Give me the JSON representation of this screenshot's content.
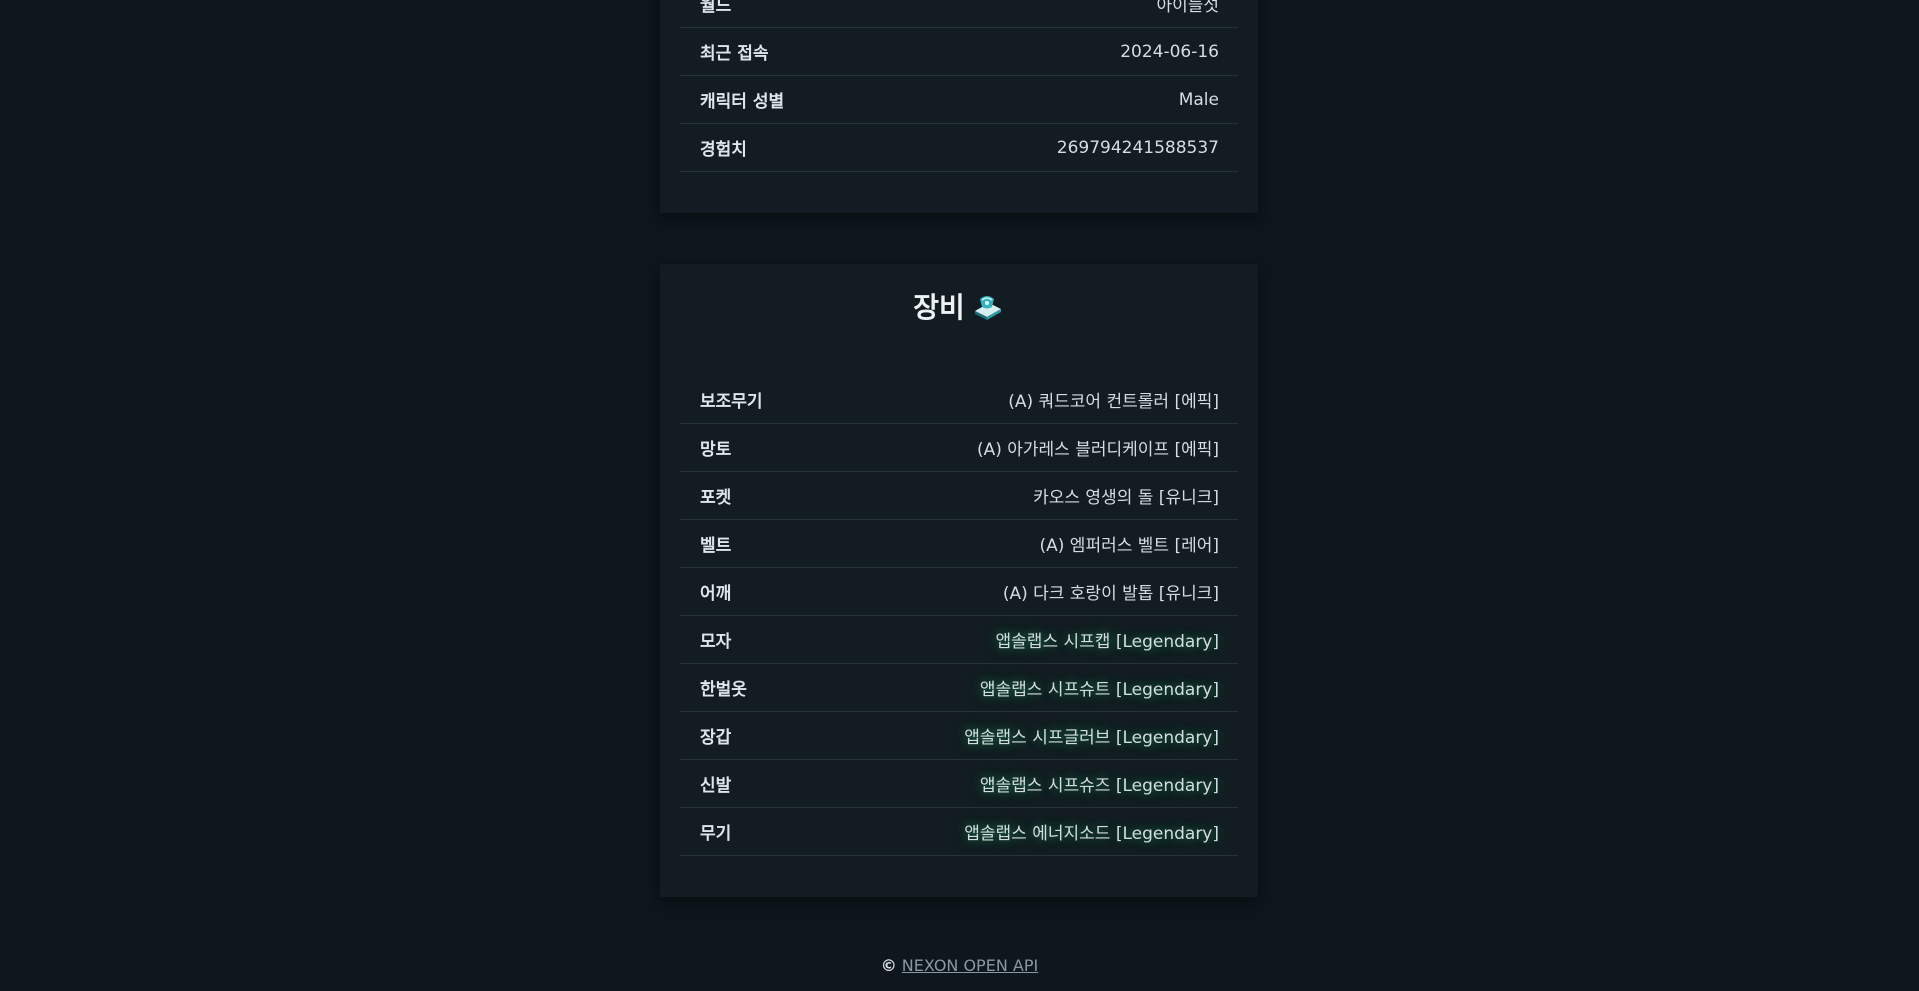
{
  "profile": {
    "rows": [
      {
        "label": "월드",
        "value": "아이들섯"
      },
      {
        "label": "최근 접속",
        "value": "2024-06-16"
      },
      {
        "label": "캐릭터 성별",
        "value": "Male"
      },
      {
        "label": "경험치",
        "value": "269794241588537"
      }
    ]
  },
  "equipment": {
    "title": "장비",
    "icon": "gear-icon",
    "items": [
      {
        "label": "보조무기",
        "value": "(A) 쿼드코어 컨트롤러 [에픽]",
        "grade": "epic"
      },
      {
        "label": "망토",
        "value": "(A) 아가레스 블러디케이프 [에픽]",
        "grade": "epic"
      },
      {
        "label": "포켓",
        "value": "카오스 영생의 돌 [유니크]",
        "grade": "unique"
      },
      {
        "label": "벨트",
        "value": "(A) 엠퍼러스 벨트 [레어]",
        "grade": "rare"
      },
      {
        "label": "어깨",
        "value": "(A) 다크 호랑이 발톱 [유니크]",
        "grade": "unique"
      },
      {
        "label": "모자",
        "value": "앱솔랩스 시프캡 [Legendary]",
        "grade": "legendary"
      },
      {
        "label": "한벌옷",
        "value": "앱솔랩스 시프슈트 [Legendary]",
        "grade": "legendary"
      },
      {
        "label": "장갑",
        "value": "앱솔랩스 시프글러브 [Legendary]",
        "grade": "legendary"
      },
      {
        "label": "신발",
        "value": "앱솔랩스 시프슈즈 [Legendary]",
        "grade": "legendary"
      },
      {
        "label": "무기",
        "value": "앱솔랩스 에너지소드 [Legendary]",
        "grade": "legendary"
      }
    ],
    "grade_colors": {
      "epic": "#9b7fdc",
      "unique": "#f3ee3c",
      "rare": "#8cd8f5",
      "legendary": "#2ef57e"
    }
  },
  "footer": {
    "copyright_symbol": "©",
    "link_text": "NEXON OPEN API"
  }
}
